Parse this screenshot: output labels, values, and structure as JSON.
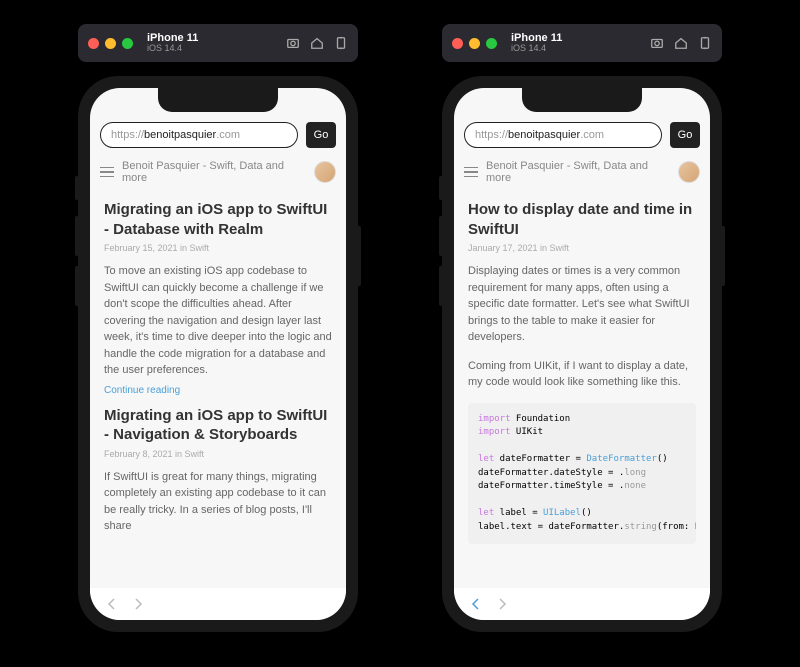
{
  "left": {
    "titlebar": {
      "device": "iPhone 11",
      "os": "iOS 14.4"
    },
    "url": {
      "prefix": "https://",
      "domain": "benoitpasquier",
      "suffix": ".com"
    },
    "go": "Go",
    "siteTitle": "Benoit Pasquier - Swift, Data and more",
    "posts": [
      {
        "title": "Migrating an iOS app to SwiftUI - Database with Realm",
        "meta": "February 15, 2021 in Swift",
        "body": "To move an existing iOS app codebase to SwiftUI can quickly become a challenge if we don't scope the difficulties ahead. After covering the navigation and design layer last week, it's time to dive deeper into the logic and handle the code migration for a database and the user preferences.",
        "more": "Continue reading"
      },
      {
        "title": "Migrating an iOS app to SwiftUI - Navigation & Storyboards",
        "meta": "February 8, 2021 in Swift",
        "body": "If SwiftUI is great for many things, migrating completely an existing app codebase to it can be really tricky. In a series of blog posts, I'll share"
      }
    ]
  },
  "right": {
    "titlebar": {
      "device": "iPhone 11",
      "os": "iOS 14.4"
    },
    "url": {
      "prefix": "https://",
      "domain": "benoitpasquier",
      "suffix": ".com"
    },
    "go": "Go",
    "siteTitle": "Benoit Pasquier - Swift, Data and more",
    "article": {
      "title": "How to display date and time in SwiftUI",
      "meta": "January 17, 2021 in Swift",
      "p1": "Displaying dates or times is a very common requirement for many apps, often using a specific date formatter. Let's see what SwiftUI brings to the table to make it easier for developers.",
      "p2": "Coming from UIKit, if I want to display a date, my code would look like something like this.",
      "code": {
        "l1a": "import",
        "l1b": " Foundation",
        "l2a": "import",
        "l2b": " UIKit",
        "l3a": "let",
        "l3b": " dateFormatter = ",
        "l3c": "DateFormatter",
        "l3d": "()",
        "l4": "dateFormatter.dateStyle = .",
        "l4b": "long",
        "l5": "dateFormatter.timeStyle = .",
        "l5b": "none",
        "l6a": "let",
        "l6b": " label = ",
        "l6c": "UILabel",
        "l6d": "()",
        "l7a": "label.text = dateFormatter.",
        "l7b": "string",
        "l7c": "(from: ",
        "l7d": "Date"
      }
    }
  }
}
